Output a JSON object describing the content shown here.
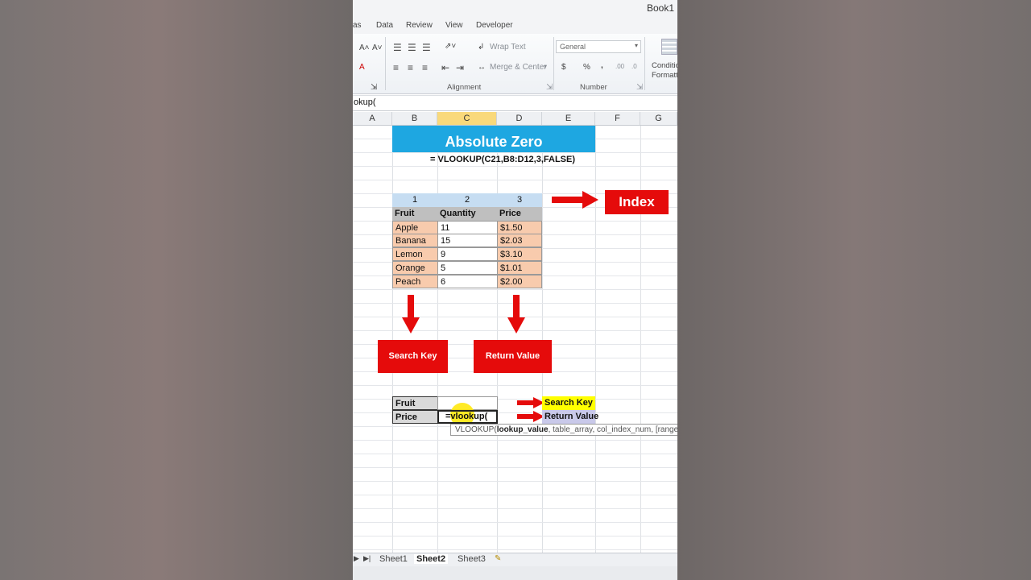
{
  "window": {
    "title": "Book1"
  },
  "ribbon_tabs": [
    "as",
    "Data",
    "Review",
    "View",
    "Developer"
  ],
  "ribbon": {
    "font_grow": "A˄",
    "font_shrink": "A˅",
    "wrap_text": "Wrap Text",
    "merge_center": "Merge & Center",
    "number_format": "General",
    "currency": "$",
    "percent": "%",
    "comma": ",",
    "increase_decimal": ".00",
    "decrease_decimal": ".0",
    "conditional": "Conditio Formattin",
    "alignment_group": "Alignment",
    "number_group": "Number"
  },
  "formula_bar": {
    "text": "okup("
  },
  "columns": [
    "A",
    "B",
    "C",
    "D",
    "E",
    "F",
    "G"
  ],
  "selected_column": "C",
  "banner": {
    "title": "Absolute Zero"
  },
  "formula_caption": "=   VLOOKUP(C21,B8:D12,3,FALSE)",
  "table": {
    "index": [
      "1",
      "2",
      "3"
    ],
    "headers": [
      "Fruit",
      "Quantity",
      "Price"
    ],
    "rows": [
      [
        "Apple",
        "11",
        "$1.50"
      ],
      [
        "Banana",
        "15",
        "$2.03"
      ],
      [
        "Lemon",
        "9",
        "$3.10"
      ],
      [
        "Orange",
        "5",
        "$1.01"
      ],
      [
        "Peach",
        "6",
        "$2.00"
      ]
    ]
  },
  "labels": {
    "index": "Index",
    "search_key": "Search Key",
    "return_value": "Return Value"
  },
  "lookup": {
    "fruit_label": "Fruit",
    "price_label": "Price",
    "fruit_value": "",
    "price_value": "=vlookup(",
    "search_key_tag": "Search Key",
    "return_value_tag": "Return Value"
  },
  "tooltip": {
    "prefix": "VLOOKUP(",
    "bold_arg": "lookup_value",
    "rest": ", table_array, col_index_num, [range"
  },
  "sheets": [
    "Sheet1",
    "Sheet2",
    "Sheet3"
  ],
  "active_sheet": "Sheet2",
  "colors": {
    "banner": "#1ea7e1",
    "red": "#e50b0b",
    "peach": "#f8cbad",
    "index_blue": "#c6ddf2",
    "header_grey": "#bfbfbf",
    "yellow": "#ffff00",
    "lavender": "#c9c9ea"
  }
}
